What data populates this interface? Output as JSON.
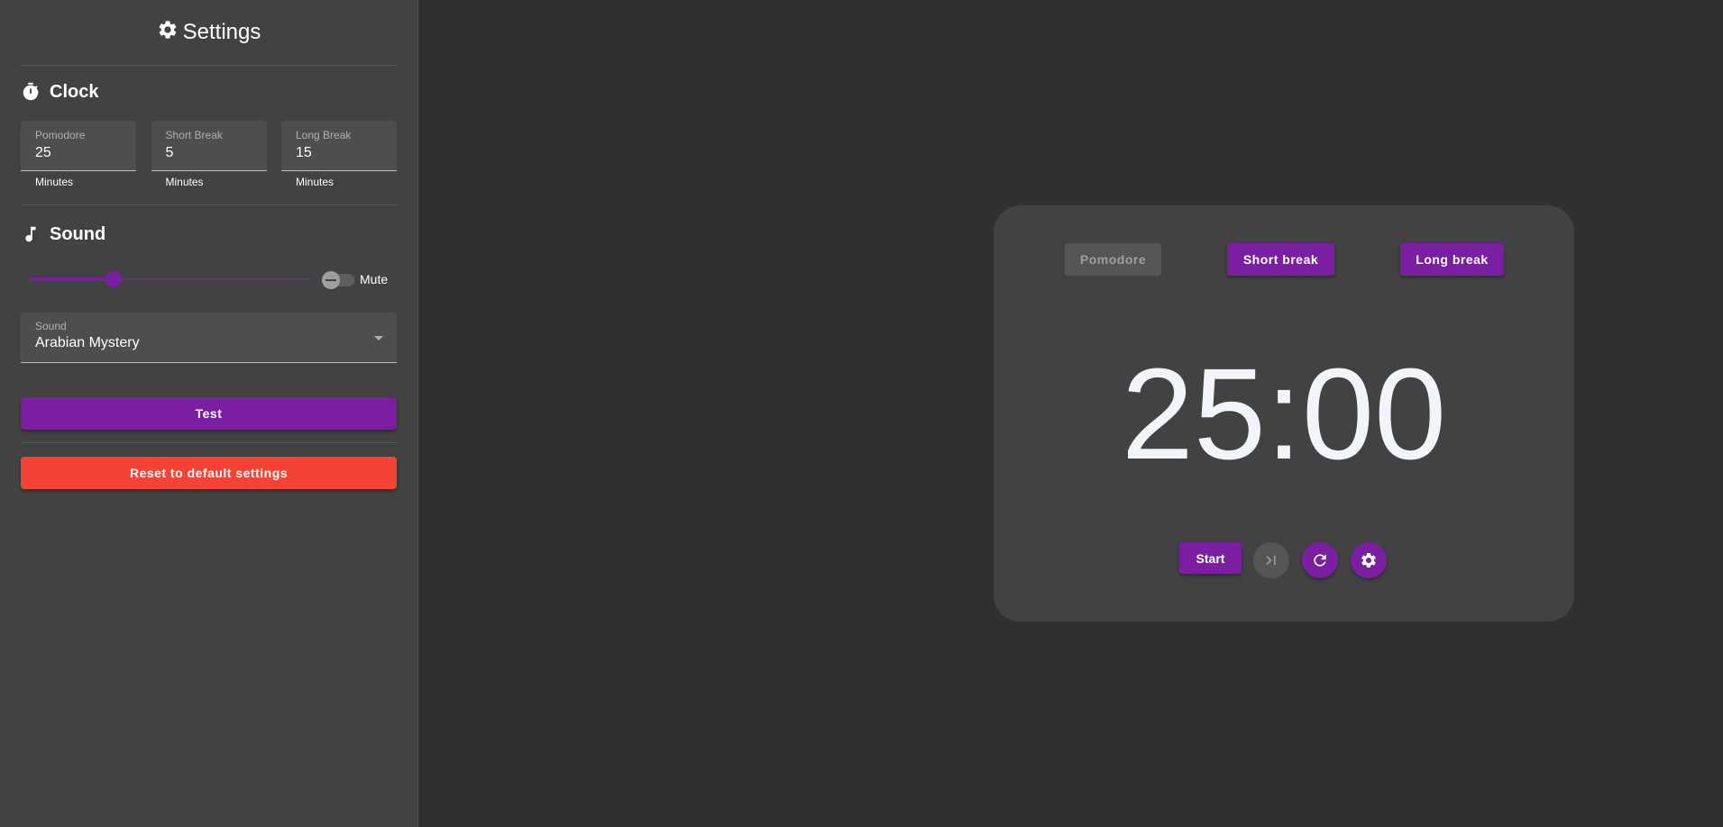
{
  "sidebar": {
    "title": "Settings",
    "clock": {
      "heading": "Clock",
      "fields": [
        {
          "label": "Pomodore",
          "value": "25",
          "helper": "Minutes"
        },
        {
          "label": "Short Break",
          "value": "5",
          "helper": "Minutes"
        },
        {
          "label": "Long Break",
          "value": "15",
          "helper": "Minutes"
        }
      ]
    },
    "sound": {
      "heading": "Sound",
      "volume_percent": 30,
      "mute_label": "Mute",
      "mute_on": false,
      "select_label": "Sound",
      "select_value": "Arabian Mystery"
    },
    "test_label": "Test",
    "reset_label": "Reset to default settings"
  },
  "timer": {
    "modes": [
      "Pomodore",
      "Short break",
      "Long break"
    ],
    "active_mode": "Pomodore",
    "display": "25:00",
    "start_label": "Start"
  },
  "icons": {
    "settings": "gear-icon",
    "clock": "stopwatch-icon",
    "sound": "music-note-icon",
    "skip": "skip-next-icon",
    "reset": "refresh-icon"
  },
  "colors": {
    "accent": "#7b1fa2",
    "danger": "#f44336",
    "background": "#303030",
    "panel": "#424242"
  }
}
